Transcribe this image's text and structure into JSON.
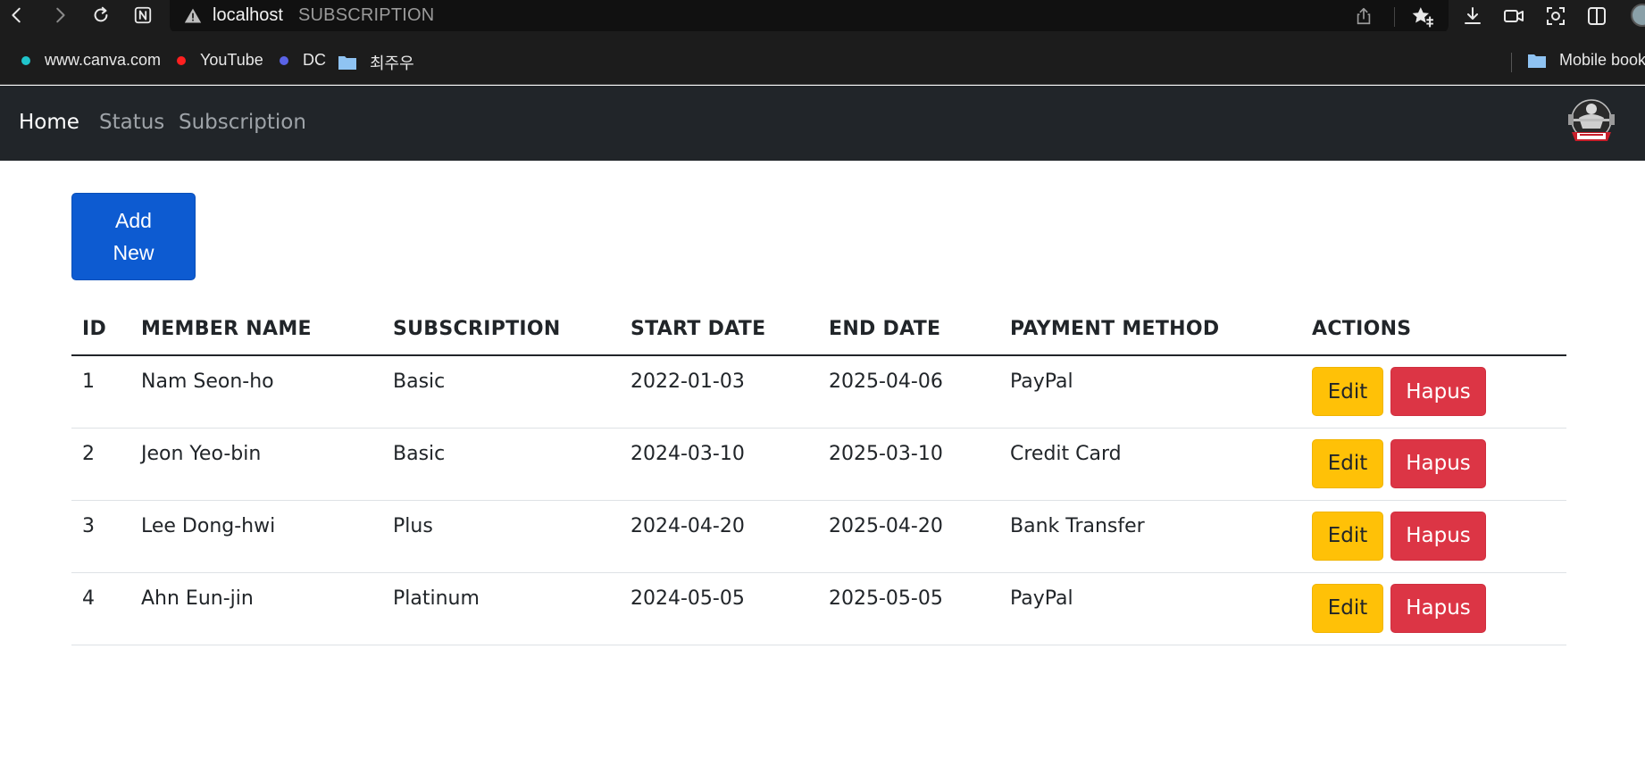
{
  "browser": {
    "address_host": "localhost",
    "address_title": "SUBSCRIPTION",
    "bookmarks": [
      {
        "label": "www.canva.com",
        "icon": "canva-dot-icon",
        "color": "#20c4cb"
      },
      {
        "label": "YouTube",
        "icon": "youtube-dot-icon",
        "color": "#ff2020"
      },
      {
        "label": "DC",
        "icon": "dc-dot-icon",
        "color": "#5a63e6"
      },
      {
        "label": "최주우",
        "icon": "folder-icon",
        "color": "#8fc3f2"
      }
    ],
    "mobile_bookmarks_label": "Mobile bookmarks"
  },
  "nav": {
    "links": [
      {
        "label": "Home",
        "active": true
      },
      {
        "label": "Status",
        "active": false
      },
      {
        "label": "Subscription",
        "active": false
      }
    ],
    "logo_icon": "fitness-logo-icon"
  },
  "main": {
    "add_button_label": "Add New",
    "table": {
      "headers": [
        "ID",
        "MEMBER NAME",
        "SUBSCRIPTION",
        "START DATE",
        "END DATE",
        "PAYMENT METHOD",
        "ACTIONS"
      ],
      "rows": [
        {
          "id": "1",
          "member_name": "Nam Seon-ho",
          "subscription": "Basic",
          "start_date": "2022-01-03",
          "end_date": "2025-04-06",
          "payment_method": "PayPal",
          "edit_label": "Edit",
          "delete_label": "Hapus"
        },
        {
          "id": "2",
          "member_name": "Jeon Yeo-bin",
          "subscription": "Basic",
          "start_date": "2024-03-10",
          "end_date": "2025-03-10",
          "payment_method": "Credit Card",
          "edit_label": "Edit",
          "delete_label": "Hapus"
        },
        {
          "id": "3",
          "member_name": "Lee Dong-hwi",
          "subscription": "Plus",
          "start_date": "2024-04-20",
          "end_date": "2025-04-20",
          "payment_method": "Bank Transfer",
          "edit_label": "Edit",
          "delete_label": "Hapus"
        },
        {
          "id": "4",
          "member_name": "Ahn Eun-jin",
          "subscription": "Platinum",
          "start_date": "2024-05-05",
          "end_date": "2025-05-05",
          "payment_method": "PayPal",
          "edit_label": "Edit",
          "delete_label": "Hapus"
        }
      ]
    }
  },
  "colors": {
    "navbar_bg": "#212529",
    "primary": "#0d5bd1",
    "warning": "#ffc107",
    "danger": "#dc3545"
  }
}
